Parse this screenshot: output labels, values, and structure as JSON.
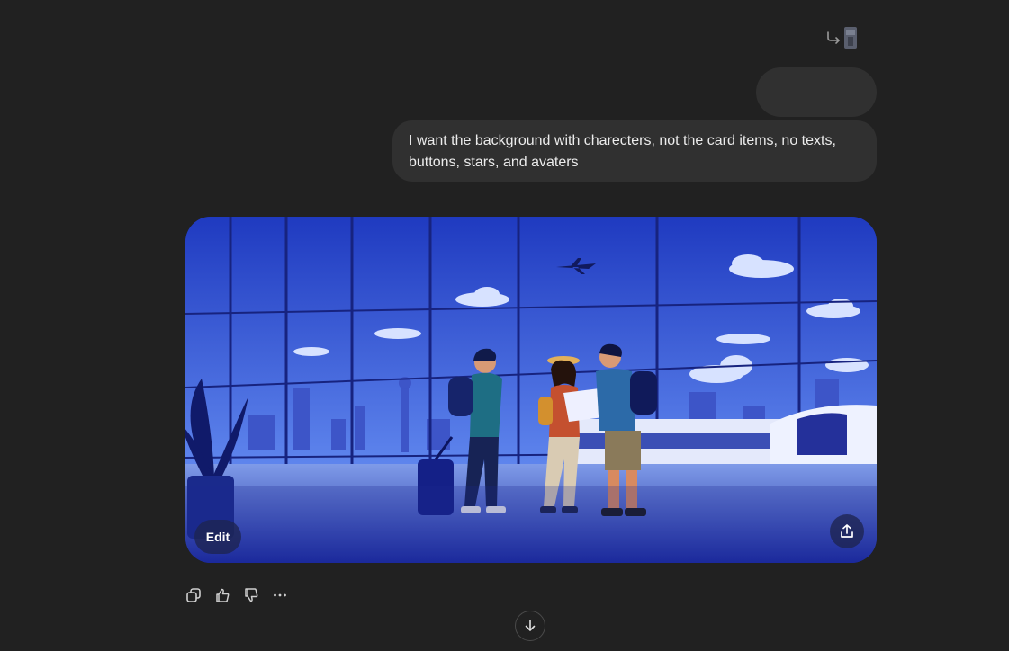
{
  "conversation": {
    "user_message": "I want the background with charecters, not the card items, no texts, buttons, stars, and avaters"
  },
  "image_card": {
    "edit_label": "Edit",
    "share_icon": "share-upload-icon"
  },
  "actions": {
    "icons": [
      "copy-icon",
      "thumbs-up-icon",
      "thumbs-down-icon",
      "more-icon"
    ]
  },
  "scroll": {
    "icon": "arrow-down-icon"
  },
  "colors": {
    "background": "#212121",
    "bubble": "#303030",
    "text": "#ececec",
    "scene_blue": "#2a3fc4"
  }
}
